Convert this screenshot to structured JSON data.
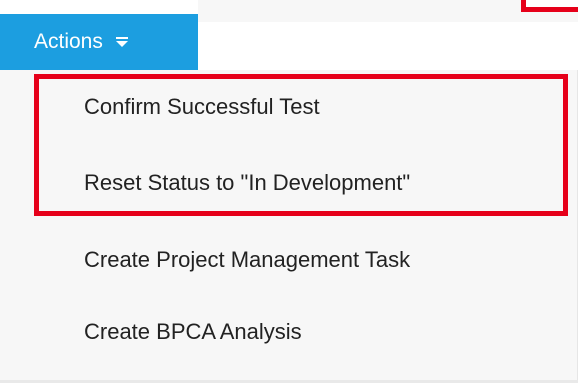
{
  "actions_button": {
    "label": "Actions",
    "icon": "chevron-down-icon",
    "color": "#1c9ee0"
  },
  "menu": {
    "items": [
      {
        "label": "Confirm Successful Test"
      },
      {
        "label": "Reset Status to \"In Development\""
      },
      {
        "label": "Create Project Management Task"
      },
      {
        "label": "Create BPCA Analysis"
      }
    ]
  },
  "annotation": {
    "highlight_color": "#e6001a"
  }
}
